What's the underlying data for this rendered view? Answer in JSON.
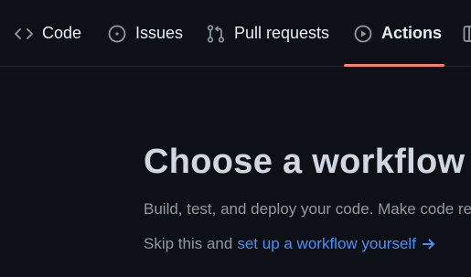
{
  "tabs": [
    {
      "label": "Code",
      "icon": "code-icon"
    },
    {
      "label": "Issues",
      "icon": "issue-opened-icon"
    },
    {
      "label": "Pull requests",
      "icon": "git-pull-request-icon"
    },
    {
      "label": "Actions",
      "icon": "play-icon",
      "active": true
    },
    {
      "label": "",
      "icon": "table-icon"
    }
  ],
  "main": {
    "title": "Choose a workflow",
    "subtitle": "Build, test, and deploy your code. Make code reviews, branch management, and issue triaging work the way you want. Select a workflow to get started.",
    "skip_prefix": "Skip this and",
    "skip_link": "set up a workflow yourself"
  },
  "colors": {
    "background": "#0d1117",
    "active_underline": "#f78166",
    "link": "#4493f8",
    "muted_text": "#9198a1"
  }
}
